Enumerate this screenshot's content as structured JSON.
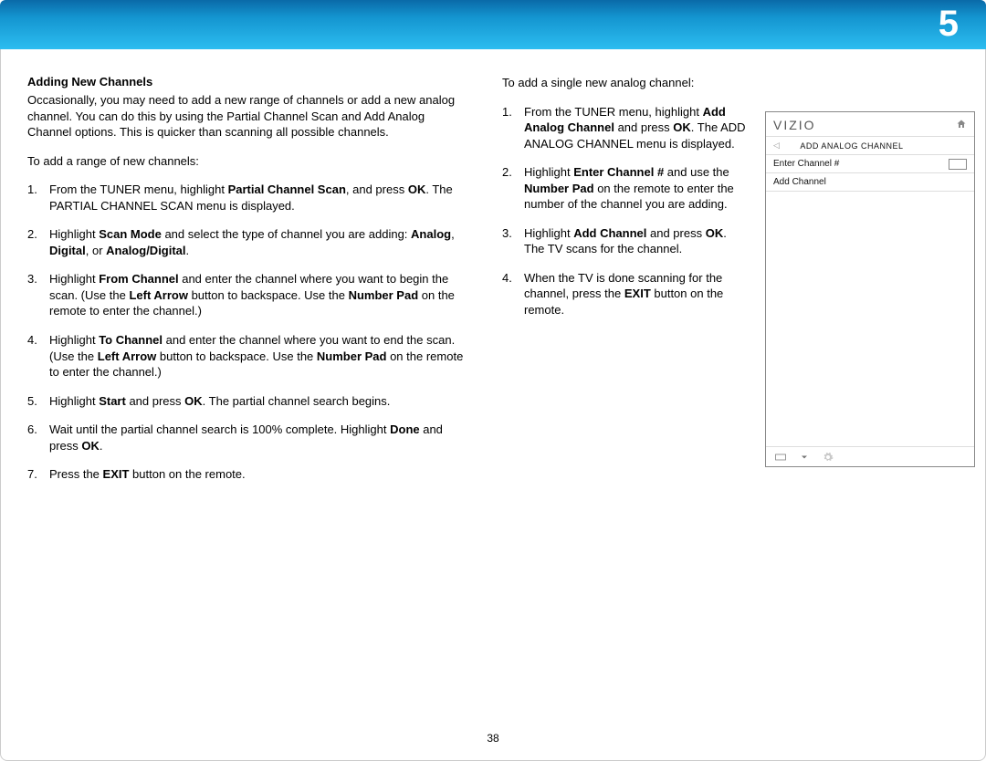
{
  "banner": {
    "chapter": "5"
  },
  "pageNum": "38",
  "left": {
    "heading": "Adding New Channels",
    "intro": "Occasionally, you may need to add a new range of channels  or add a new analog channel. You can do this by using the Partial Channel Scan and Add Analog Channel options. This is quicker than scanning all possible channels.",
    "lead": "To add a range of new channels:",
    "steps": [
      {
        "n": "1.",
        "pre": "From the TUNER menu, highlight ",
        "b1": "Partial Channel Scan",
        "mid": ", and press ",
        "b2": "OK",
        "post": ". The PARTIAL CHANNEL SCAN menu is displayed."
      },
      {
        "n": "2.",
        "pre": "Highlight ",
        "b1": "Scan Mode",
        "mid": " and select the type of channel you are adding: ",
        "b2": "Analog",
        "mid2": ", ",
        "b3": "Digital",
        "mid3": ", or ",
        "b4": "Analog/Digital",
        "post": "."
      },
      {
        "n": "3.",
        "pre": "Highlight ",
        "b1": "From Channel",
        "mid": " and enter the channel where you want to begin the scan. (Use the ",
        "b2": "Left Arrow",
        "mid2": " button to backspace. Use the ",
        "b3": "Number Pad",
        "post": " on the remote to enter the channel.)"
      },
      {
        "n": "4.",
        "pre": "Highlight ",
        "b1": "To Channel",
        "mid": " and enter the channel where you want to end the scan. (Use the ",
        "b2": "Left Arrow",
        "mid2": "  button to backspace. Use the ",
        "b3": "Number Pad",
        "post": " on the remote to enter the channel.)"
      },
      {
        "n": "5.",
        "pre": "Highlight ",
        "b1": "Start",
        "mid": " and press ",
        "b2": "OK",
        "post": ". The partial channel search begins."
      },
      {
        "n": "6.",
        "pre": "Wait until the partial channel search is 100% complete. Highlight ",
        "b1": "Done",
        "mid": " and press ",
        "b2": "OK",
        "post": "."
      },
      {
        "n": "7.",
        "pre": "Press the ",
        "b1": "EXIT",
        "post": " button on the remote."
      }
    ]
  },
  "right": {
    "lead": "To add a single new analog channel:",
    "steps": [
      {
        "n": "1.",
        "pre": "From the TUNER menu, highlight ",
        "b1": "Add Analog Channel",
        "mid": " and press ",
        "b2": "OK",
        "post": ". The ADD ANALOG CHANNEL menu is displayed."
      },
      {
        "n": "2.",
        "pre": "Highlight ",
        "b1": "Enter Channel #",
        "mid": " and use the ",
        "b2": "Number Pad",
        "post": " on the remote to enter the number of the channel you are adding."
      },
      {
        "n": "3.",
        "pre": "Highlight ",
        "b1": "Add Channel",
        "mid": " and press ",
        "b2": "OK",
        "post": ". The TV scans for the channel."
      },
      {
        "n": "4.",
        "pre": "When the TV is done scanning for the channel, press the ",
        "b1": "EXIT",
        "post": " button on the remote."
      }
    ]
  },
  "menu": {
    "brand": "VIZIO",
    "title": "ADD ANALOG CHANNEL",
    "row1": "Enter Channel #",
    "row2": "Add Channel"
  }
}
